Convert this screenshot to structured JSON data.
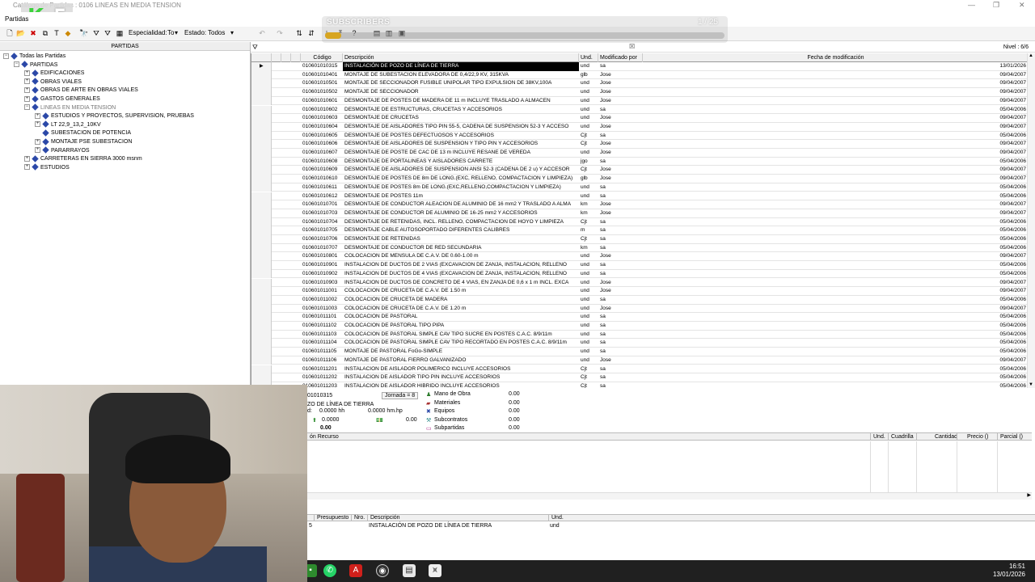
{
  "window": {
    "title": "Catálogo de Partidas : 0106  LINEAS EN MEDIA TENSION"
  },
  "menu": {
    "item": "Partidas"
  },
  "toolbar": {
    "especialidad_label": "Especialidad:",
    "especialidad_value": "To",
    "estado_label": "Estado:",
    "estado_value": "Todos"
  },
  "overlay": {
    "subscribers": "SUBSCRIBERS",
    "count": "1 / 25",
    "progress": 0.04
  },
  "tree": {
    "header": "PARTIDAS",
    "nodes": [
      {
        "label": "Todas las Partidas",
        "depth": 0,
        "exp": "−"
      },
      {
        "label": "PARTIDAS",
        "depth": 1,
        "exp": "−"
      },
      {
        "label": "EDIFICACIONES",
        "depth": 2,
        "exp": "+"
      },
      {
        "label": "OBRAS VIALES",
        "depth": 2,
        "exp": "+"
      },
      {
        "label": "OBRAS DE ARTE EN OBRAS VIALES",
        "depth": 2,
        "exp": "+"
      },
      {
        "label": "GASTOS GENERALES",
        "depth": 2,
        "exp": "+"
      },
      {
        "label": "LINEAS EN MEDIA TENSION",
        "depth": 2,
        "exp": "−",
        "dim": true
      },
      {
        "label": "ESTUDIOS Y PROYECTOS, SUPERVISION, PRUEBAS",
        "depth": 3,
        "exp": "+"
      },
      {
        "label": "LT 22,9_13,2_10KV",
        "depth": 3,
        "exp": "+"
      },
      {
        "label": "SUBESTACION DE POTENCIA",
        "depth": 3,
        "exp": ""
      },
      {
        "label": "MONTAJE PSE SUBESTACION",
        "depth": 3,
        "exp": "+"
      },
      {
        "label": "PARARRAYOS",
        "depth": 3,
        "exp": "+"
      },
      {
        "label": "CARRETERAS EN SIERRA 3000 msnm",
        "depth": 2,
        "exp": "+"
      },
      {
        "label": "ESTUDIOS",
        "depth": 2,
        "exp": "+"
      }
    ]
  },
  "grid": {
    "nivel": "Nivel : 6/6",
    "columns": {
      "codigo": "Código",
      "descripcion": "Descripción",
      "und": "Und.",
      "modificado": "Modificado por",
      "fecha": "Fecha de modificación"
    },
    "rows": [
      [
        "010601010315",
        "INSTALACIÓN DE POZO DE LÍNEA DE TIERRA",
        "und",
        "sa",
        "13/01/2026"
      ],
      [
        "010601010401",
        "MONTAJE DE SUBESTACION ELEVADORA DE 0,4/22,9 KV, 315KVA",
        "glb",
        "Jose",
        "09/04/2007"
      ],
      [
        "010601010501",
        "MONTAJE DE SECCIONADOR FUSIBLE UNIPOLAR TIPO EXPULSION DE 38KV,100A",
        "und",
        "Jose",
        "09/04/2007"
      ],
      [
        "010601010502",
        "MONTAJE DE SECCIONADOR",
        "und",
        "Jose",
        "09/04/2007"
      ],
      [
        "010601010601",
        "DESMONTAJE DE POSTES DE MADERA DE 11 m INCLUYE TRASLADO A ALMACEN",
        "und",
        "Jose",
        "09/04/2007"
      ],
      [
        "010601010602",
        "DESMONTAJE DE ESTRUCTURAS, CRUCETAS Y ACCESORIOS",
        "und",
        "sa",
        "05/04/2006"
      ],
      [
        "010601010603",
        "DESMONTAJE DE CRUCETAS",
        "und",
        "Jose",
        "09/04/2007"
      ],
      [
        "010601010604",
        "DESMONTAJE DE AISLADORES TIPO PIN 55-5, CADENA DE SUSPENSION 52-3 Y ACCESO",
        "und",
        "Jose",
        "09/04/2007"
      ],
      [
        "010601010605",
        "DESMONTAJE DE POSTES DEFECTUOSOS Y ACCESORIOS",
        "Cjt",
        "sa",
        "05/04/2006"
      ],
      [
        "010601010606",
        "DESMONTAJE DE AISLADORES DE SUSPENSION Y TIPO PIN Y ACCESORIOS",
        "Cjt",
        "Jose",
        "09/04/2007"
      ],
      [
        "010601010607",
        "DESMONTAJE DE POSTE DE CAC DE 13 m INCLUYE RESANE DE VEREDA",
        "und",
        "Jose",
        "09/04/2007"
      ],
      [
        "010601010608",
        "DESMONTAJE DE PORTALINEAS Y AISLADORES CARRETE",
        "jgo",
        "sa",
        "05/04/2006"
      ],
      [
        "010601010609",
        "DESMONTAJE DE AISLADORES DE SUSPENSION ANSI 52-3 (CADENA DE 2 u) Y ACCESOR",
        "Cjt",
        "Jose",
        "09/04/2007"
      ],
      [
        "010601010610",
        "DESMONTAJE DE POSTES DE 8m DE LONG.(EXC, RELLENO, COMPACTACION Y LIMPIEZA)",
        "glb",
        "Jose",
        "09/04/2007"
      ],
      [
        "010601010611",
        "DESMONTAJE DE POSTES 8m DE LONG.(EXC,RELLENO,COMPACTACION Y LIMPIEZA)",
        "und",
        "sa",
        "05/04/2006"
      ],
      [
        "010601010612",
        "DESMONTAJE DE POSTES 11m",
        "und",
        "sa",
        "05/04/2006"
      ],
      [
        "010601010701",
        "DESMONTAJE DE CONDUCTOR ALEACION DE ALUMINIO DE 16 mm2 Y TRASLADO A ALMA",
        "km",
        "Jose",
        "09/04/2007"
      ],
      [
        "010601010703",
        "DESMONTAJE  DE CONDUCTOR DE ALUMINIO DE 16-25 mm2 Y ACCESORIOS",
        "km",
        "Jose",
        "09/04/2007"
      ],
      [
        "010601010704",
        "DESMONTAJE  DE RETENIDAS, INCL. RELLENO, COMPACTACION DE HOYO Y LIMPIEZA",
        "Cjt",
        "sa",
        "05/04/2006"
      ],
      [
        "010601010705",
        "DESMONTAJE  CABLE AUTOSOPORTADO DIFERENTES CALIBRES",
        "m",
        "sa",
        "05/04/2006"
      ],
      [
        "010601010706",
        "DESMONTAJE  DE RETENIDAS",
        "Cjt",
        "sa",
        "05/04/2006"
      ],
      [
        "010601010707",
        "DESMONTAJE  DE CONDUCTOR DE RED SECUNDARIA",
        "km",
        "sa",
        "05/04/2006"
      ],
      [
        "010601010801",
        "COLOCACION DE MENSULA DE C.A.V. DE 0.60-1.00 m",
        "und",
        "Jose",
        "09/04/2007"
      ],
      [
        "010601010901",
        "INSTALACION DE DUCTOS DE 2 VIAS (EXCAVACION DE ZANJA, INSTALACION, RELLENO",
        "und",
        "sa",
        "05/04/2006"
      ],
      [
        "010601010902",
        "INSTALACION DE DUCTOS DE 4 VIAS (EXCAVACION DE ZANJA, INSTALACION, RELLENO",
        "und",
        "sa",
        "05/04/2006"
      ],
      [
        "010601010903",
        "INSTALACION DE DUCTOS DE CONCRETO DE 4 VIAS, EN ZANJA DE 0,6 x 1 m INCL. EXCA",
        "und",
        "Jose",
        "09/04/2007"
      ],
      [
        "010601011001",
        "COLOCACION DE CRUCETA DE C.A.V. DE 1.50 m",
        "und",
        "Jose",
        "09/04/2007"
      ],
      [
        "010601011002",
        "COLOCACION DE CRUCETA DE MADERA",
        "und",
        "sa",
        "05/04/2006"
      ],
      [
        "010601011003",
        "COLOCACION DE CRUCETA DE C.A.V. DE 1.20 m",
        "und",
        "Jose",
        "09/04/2007"
      ],
      [
        "010601011101",
        "COLOCACION DE PASTORAL",
        "und",
        "sa",
        "05/04/2006"
      ],
      [
        "010601011102",
        "COLOCACION DE PASTORAL TIPO PIPA",
        "und",
        "sa",
        "05/04/2006"
      ],
      [
        "010601011103",
        "COLOCACION DE PASTORAL SIMPLE CAV TIPO SUCRE EN POSTES C.A.C. 8/9/11m",
        "und",
        "sa",
        "05/04/2006"
      ],
      [
        "010601011104",
        "COLOCACION DE PASTORAL SIMPLE CAV TIPO RECORTADO EN POSTES C.A.C. 8/9/11m",
        "und",
        "sa",
        "05/04/2006"
      ],
      [
        "010601011105",
        "MONTAJE DE PASTORAL FoGo-SIMPLE",
        "und",
        "sa",
        "05/04/2006"
      ],
      [
        "010601011106",
        "MONTAJE DE PASTORAL FIERRO GALVANIZADO",
        "und",
        "Jose",
        "09/04/2007"
      ],
      [
        "010601011201",
        "INSTALACION DE AISLADOR POLIMERICO INCLUYE ACCESORIOS",
        "Cjt",
        "sa",
        "05/04/2006"
      ],
      [
        "010601011202",
        "INSTALACION DE AISLADOR TIPO PIN INCLUYE ACCESORIOS",
        "Cjt",
        "sa",
        "05/04/2006"
      ],
      [
        "010601011203",
        "INSTALACION DE AISLADOR HIBRIDO INCLUYE ACCESORIOS",
        "Cjt",
        "sa",
        "05/04/2006"
      ]
    ]
  },
  "detail": {
    "code": "01010315",
    "desc": "ZO DE LÍNEA DE TIERRA",
    "jornada": "Jornada = 8",
    "hh": "0.0000 hh",
    "hmp": "0.0000 hm.hp",
    "qty": "0.0000",
    "amount": "0.00",
    "total": "0.00",
    "d_label": "d:",
    "costs": [
      {
        "label": "Mano de Obra",
        "value": "0.00"
      },
      {
        "label": "Materiales",
        "value": "0.00"
      },
      {
        "label": "Equipos",
        "value": "0.00"
      },
      {
        "label": "Subcontratos",
        "value": "0.00"
      },
      {
        "label": "Subpartidas",
        "value": "0.00"
      }
    ]
  },
  "resources": {
    "col_recurso": "ón Recurso",
    "col_und": "Und.",
    "col_cuadrilla": "Cuadrilla",
    "col_cantidad": "Cantidad",
    "col_precio": "Precio ()",
    "col_parcial": "Parcial ()"
  },
  "presupuesto": {
    "col_presupuesto": "Presupuesto",
    "col_nro": "Nro.",
    "col_descripcion": "Descripción",
    "col_und": "Und.",
    "row": {
      "presupuesto": "5",
      "descripcion": "INSTALACIÓN DE POZO DE LÍNEA DE TIERRA",
      "und": "und"
    }
  },
  "taskbar": {
    "time": "16:51",
    "date": "13/01/2026"
  },
  "colors": {
    "selected_row": "#000000",
    "tree_icon": "#2b48a8",
    "accent": "#d7a520"
  }
}
